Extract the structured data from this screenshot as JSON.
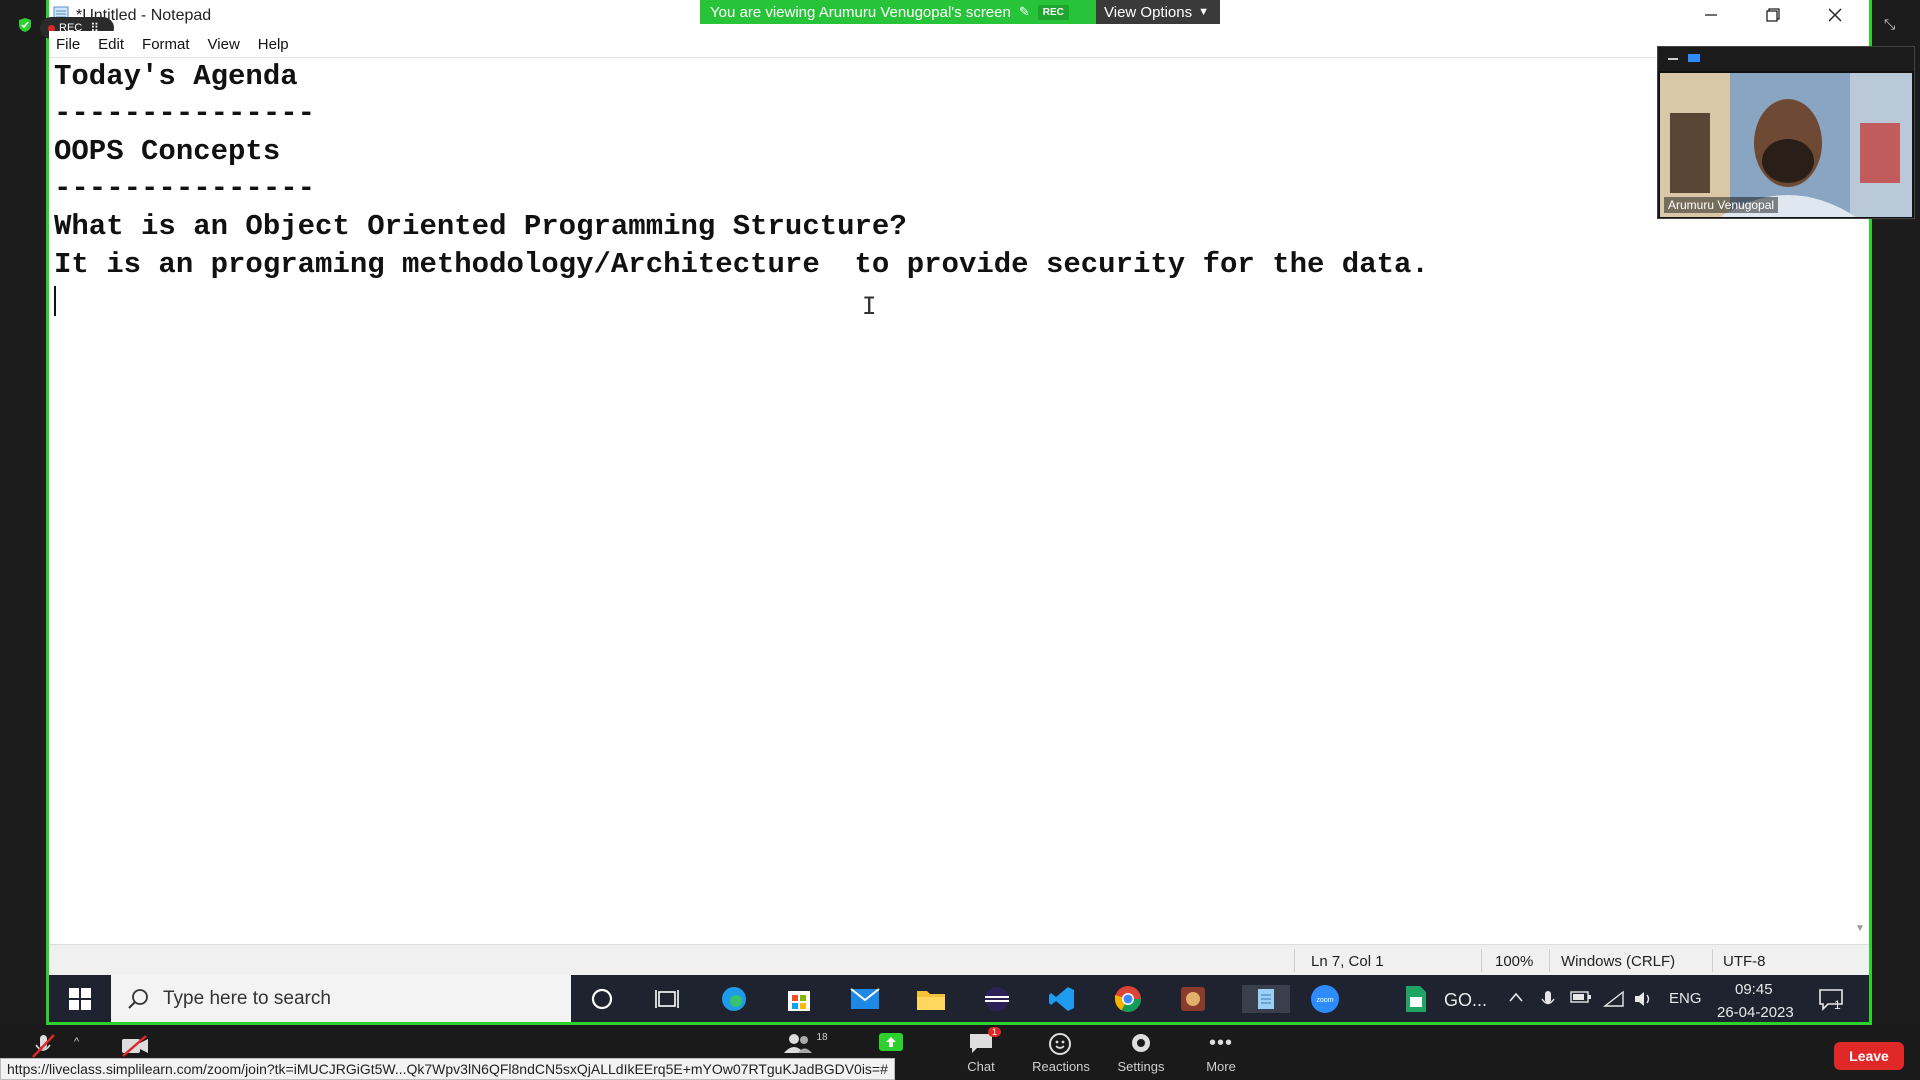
{
  "zoom": {
    "rec_badge": "REC",
    "banner_text": "You are viewing Arumuru Venugopal's screen",
    "banner_rec": "REC",
    "view_options": "View Options",
    "participant_name": "Arumuru Venugopal",
    "participants_count": "18",
    "chat_badge": "1",
    "buttons": {
      "chat": "Chat",
      "reactions": "Reactions",
      "settings": "Settings",
      "more": "More",
      "leave": "Leave"
    },
    "accent": "#2dd12d",
    "leave_color": "#e02828"
  },
  "notepad": {
    "title": "*Untitled - Notepad",
    "menu": [
      "File",
      "Edit",
      "Format",
      "View",
      "Help"
    ],
    "lines": [
      "Today's Agenda",
      "---------------",
      "OOPS Concepts",
      "---------------",
      "What is an Object Oriented Programming Structure?",
      "It is an programing methodology/Architecture  to provide security for the data.",
      ""
    ],
    "status": {
      "position": "Ln 7, Col 1",
      "zoom": "100%",
      "line_endings": "Windows (CRLF)",
      "encoding": "UTF-8"
    }
  },
  "taskbar": {
    "search_placeholder": "Type here to search",
    "pinned": [
      "cortana-icon",
      "task-view-icon",
      "edge-icon",
      "store-icon",
      "mail-icon",
      "file-explorer-icon",
      "eclipse-icon",
      "vscode-icon",
      "chrome-icon",
      "app-icon",
      "notepad-icon",
      "zoom-icon",
      "sheets-icon"
    ],
    "go_label": "GO...",
    "language": "ENG",
    "time": "09:45",
    "date": "26-04-2023",
    "notification_count": "1"
  },
  "browser": {
    "status_url": "https://liveclass.simplilearn.com/zoom/join?tk=iMUCJRGiGt5W...Qk7Wpv3lN6QFl8ndCN5sxQjALLdIkEErq5E+mYOw07RTguKJadBGDV0is=#"
  }
}
